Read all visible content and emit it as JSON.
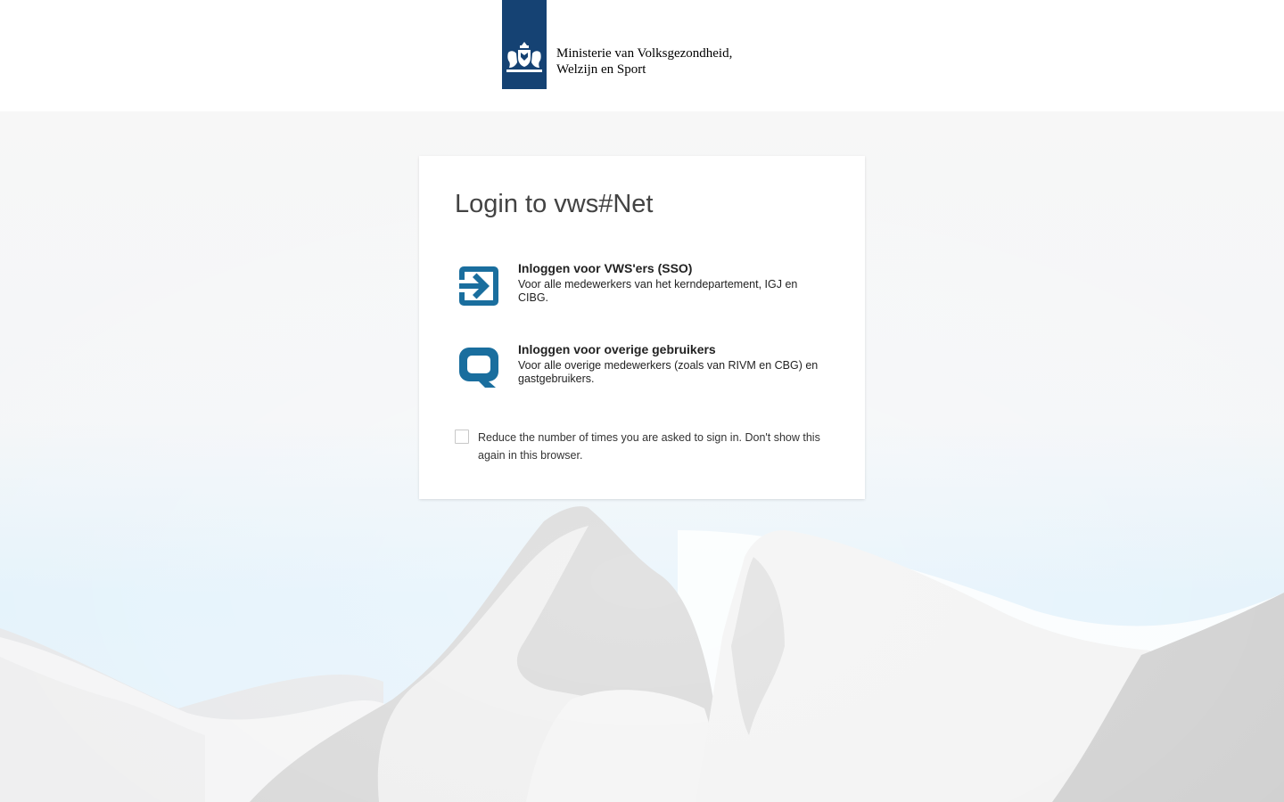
{
  "header": {
    "logo_name": "rijksoverheid-coat-of-arms-icon",
    "organization_line1": "Ministerie van Volksgezondheid,",
    "organization_line2": "Welzijn en Sport"
  },
  "login": {
    "title": "Login to vws#Net",
    "options": [
      {
        "icon": "sign-in-arrow-icon",
        "title": "Inloggen voor VWS'ers (SSO)",
        "description": "Voor alle medewerkers van het kerndepartement, IGJ en CIBG."
      },
      {
        "icon": "q-logo-icon",
        "title": "Inloggen voor overige gebruikers",
        "description": "Voor alle overige medewerkers (zoals van RIVM en CBG) en gastgebruikers."
      }
    ],
    "remember_label": "Reduce the number of times you are asked to sign in. Don't show this again in this browser.",
    "remember_checked": false
  },
  "colors": {
    "brand_blue": "#154273",
    "icon_blue": "#1a6e9e",
    "page_background": "#f7f7f7"
  }
}
